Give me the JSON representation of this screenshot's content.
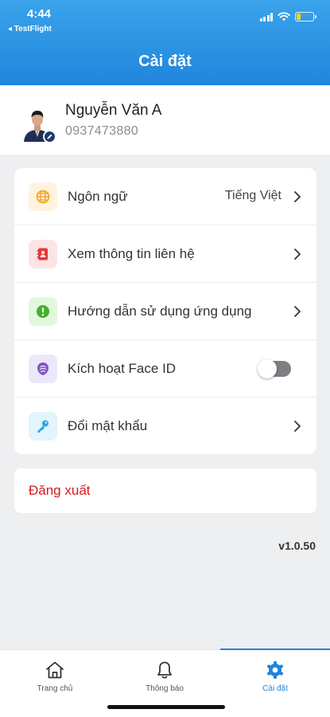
{
  "status_bar": {
    "time": "4:44",
    "back_app": "◂ TestFlight",
    "battery_level": 0.25,
    "battery_color": "#ffd60a"
  },
  "header": {
    "title": "Cài đặt"
  },
  "profile": {
    "name": "Nguyễn Văn A",
    "phone": "0937473880"
  },
  "settings": [
    {
      "icon": "globe-icon",
      "label": "Ngôn ngữ",
      "value": "Tiếng Việt",
      "control": "chevron",
      "icon_bg": "#fff3e0",
      "icon_color": "#f5a623"
    },
    {
      "icon": "contact-card-icon",
      "label": "Xem thông tin liên hệ",
      "control": "chevron",
      "icon_bg": "#fde4e4",
      "icon_color": "#e53935"
    },
    {
      "icon": "info-icon",
      "label": "Hướng dẫn sử dụng ứng dụng",
      "control": "chevron",
      "icon_bg": "#e3f7df",
      "icon_color": "#43b02a"
    },
    {
      "icon": "face-id-icon",
      "label": "Kích hoạt Face ID",
      "control": "toggle",
      "toggle_on": false,
      "icon_bg": "#ece8fb",
      "icon_color": "#7e57c2"
    },
    {
      "icon": "key-icon",
      "label": "Đổi mật khẩu",
      "control": "chevron",
      "icon_bg": "#e2f4fc",
      "icon_color": "#29a9e1"
    }
  ],
  "logout": {
    "label": "Đăng xuất",
    "color": "#d71921"
  },
  "version": "v1.0.50",
  "tabs": [
    {
      "icon": "home-icon",
      "label": "Trang chủ",
      "active": false
    },
    {
      "icon": "bell-icon",
      "label": "Thông báo",
      "active": false
    },
    {
      "icon": "gear-icon",
      "label": "Cài đặt",
      "active": true
    }
  ],
  "accent": "#1f84d9"
}
